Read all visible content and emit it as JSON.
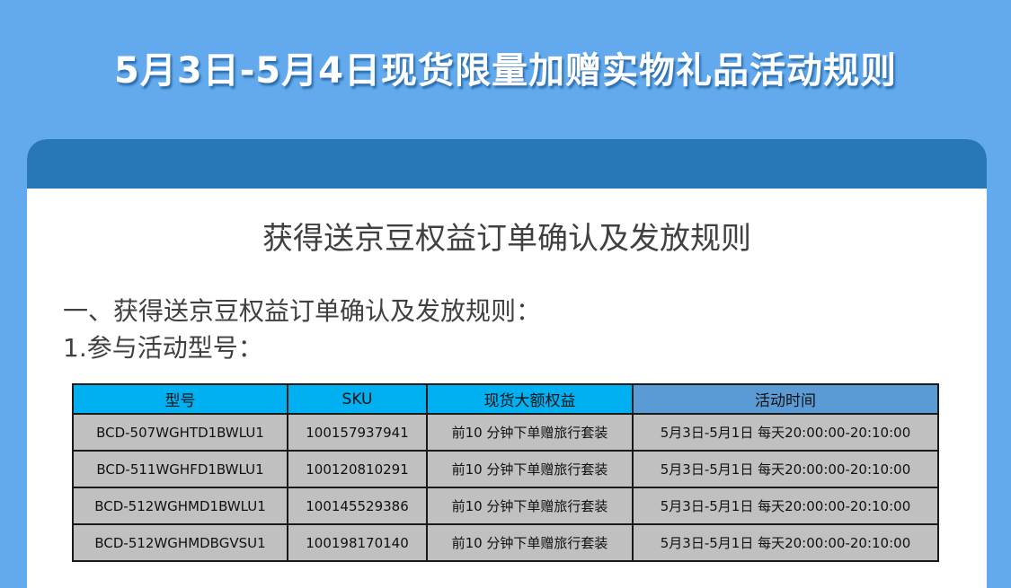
{
  "banner": {
    "title": "5月3日-5月4日现货限量加赠实物礼品活动规则"
  },
  "card": {
    "heading": "获得送京豆权益订单确认及发放规则",
    "section_title": "一、获得送京豆权益订单确认及发放规则：",
    "sub_title": "1.参与活动型号："
  },
  "table": {
    "headers": [
      "型号",
      "SKU",
      "现货大额权益",
      "活动时间"
    ],
    "rows": [
      [
        "BCD-507WGHTD1BWLU1",
        "100157937941",
        "前10 分钟下单赠旅行套装",
        "5月3日-5月1日 每天20:00:00-20:10:00"
      ],
      [
        "BCD-511WGHFD1BWLU1",
        "100120810291",
        "前10 分钟下单赠旅行套装",
        "5月3日-5月1日 每天20:00:00-20:10:00"
      ],
      [
        "BCD-512WGHMD1BWLU1",
        "100145529386",
        "前10 分钟下单赠旅行套装",
        "5月3日-5月1日 每天20:00:00-20:10:00"
      ],
      [
        "BCD-512WGHMDBGVSU1",
        "100198170140",
        "前10 分钟下单赠旅行套装",
        "5月3日-5月1日 每天20:00:00-20:10:00"
      ]
    ]
  },
  "colors": {
    "background": "#62aaed",
    "card_header": "#2878b7",
    "table_header": "#00b0f0",
    "table_header_time": "#5b9bd5",
    "table_cell": "#c0c0c0"
  }
}
